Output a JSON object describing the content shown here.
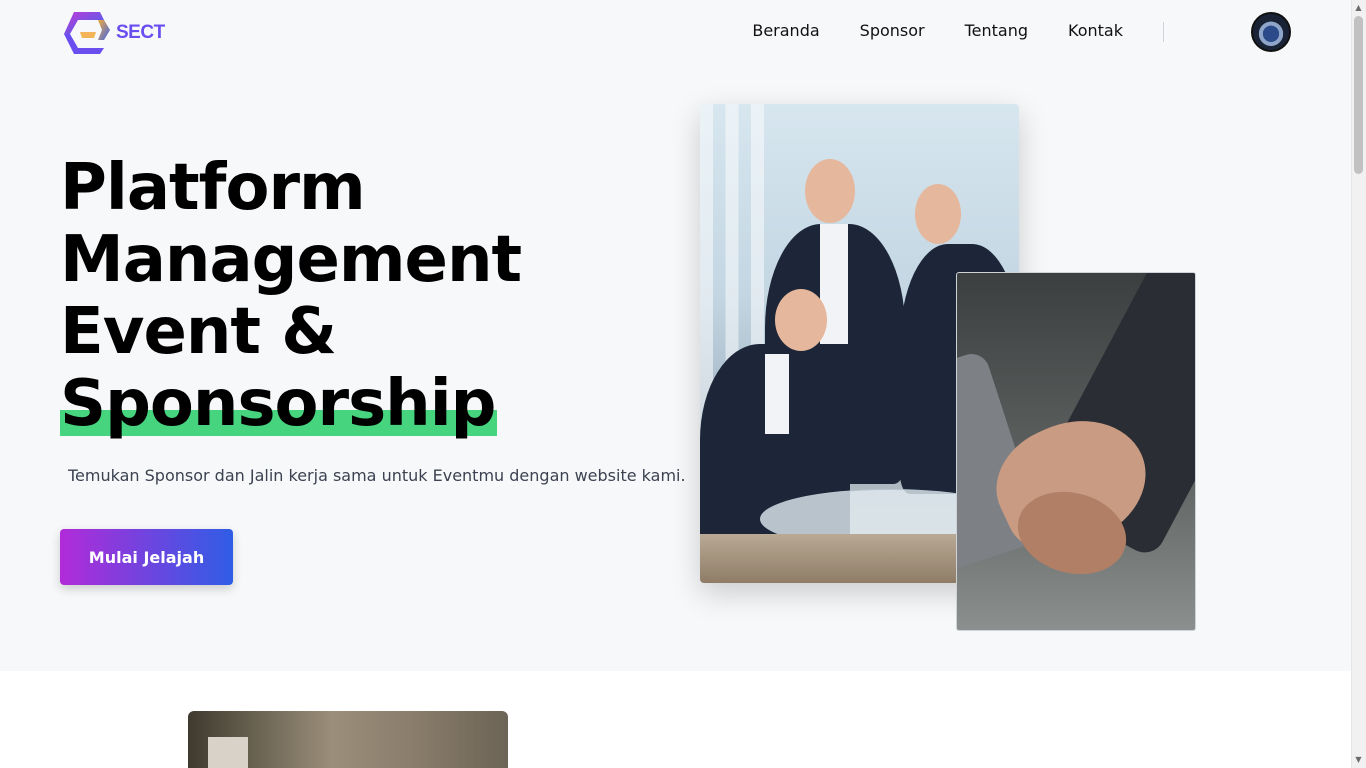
{
  "nav": {
    "logo_text": "SECT",
    "items": [
      {
        "label": "Beranda"
      },
      {
        "label": "Sponsor"
      },
      {
        "label": "Tentang"
      },
      {
        "label": "Kontak"
      }
    ]
  },
  "hero": {
    "title_lines": [
      "Platform",
      "Management",
      "Event &",
      "Sponsorship"
    ],
    "subtitle": "Temukan Sponsor dan Jalin kerja sama untuk Eventmu dengan website kami.",
    "cta_label": "Mulai Jelajah"
  },
  "colors": {
    "highlight": "#46d47f",
    "cta_gradient_start": "#b12bd8",
    "cta_gradient_end": "#2f5de6",
    "logo_accent": "#6b4ef0"
  },
  "icons": {
    "scroll_up": "▲",
    "scroll_down": "▼"
  }
}
